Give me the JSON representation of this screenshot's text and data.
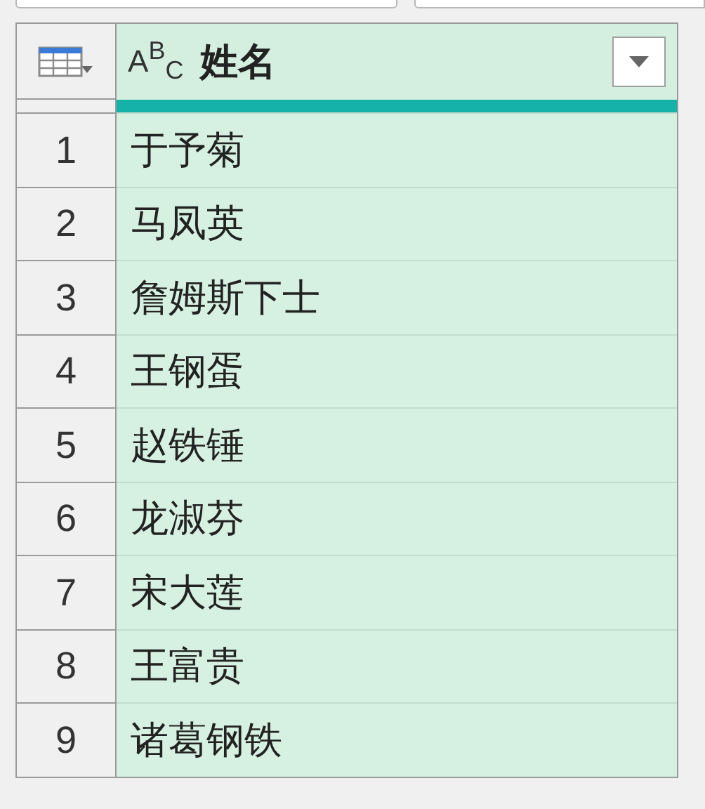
{
  "column": {
    "type_label": "A$^{B}$$_{C}$",
    "name": "姓名"
  },
  "rows": [
    {
      "index": "1",
      "name": "于予菊"
    },
    {
      "index": "2",
      "name": "马凤英"
    },
    {
      "index": "3",
      "name": "詹姆斯下士"
    },
    {
      "index": "4",
      "name": "王钢蛋"
    },
    {
      "index": "5",
      "name": "赵铁锤"
    },
    {
      "index": "6",
      "name": "龙淑芬"
    },
    {
      "index": "7",
      "name": "宋大莲"
    },
    {
      "index": "8",
      "name": "王富贵"
    },
    {
      "index": "9",
      "name": "诸葛钢铁"
    }
  ]
}
